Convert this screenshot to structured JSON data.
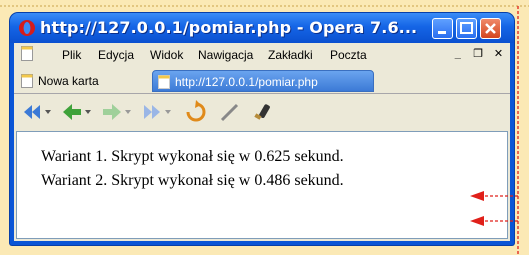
{
  "window": {
    "title": "http://127.0.0.1/pomiar.php - Opera 7.6...",
    "controls": {
      "minimize_icon": "minimize-icon",
      "maximize_icon": "maximize-icon",
      "close_icon": "close-icon"
    }
  },
  "menu": {
    "items": [
      "Plik",
      "Edycja",
      "Widok",
      "Nawigacja",
      "Zakładki",
      "Poczta"
    ],
    "mdi_buttons": [
      "_",
      "❐",
      "✕"
    ]
  },
  "tabs": [
    {
      "label": "Nowa karta",
      "active": false
    },
    {
      "label": "http://127.0.0.1/pomiar.php",
      "active": true
    }
  ],
  "toolbar": {
    "buttons": [
      "rewind-icon",
      "back-icon",
      "forward-icon",
      "fast-forward-icon",
      "reload-icon",
      "edit-icon",
      "wand-icon"
    ]
  },
  "page": {
    "lines": [
      "Wariant 1. Skrypt wykonał się w 0.625 sekund.",
      "Wariant 2. Skrypt wykonał się w 0.486 sekund."
    ]
  },
  "colors": {
    "annotation": "#e0201a",
    "titlebar": "#0a55d6",
    "background": "#fbe9b5"
  }
}
